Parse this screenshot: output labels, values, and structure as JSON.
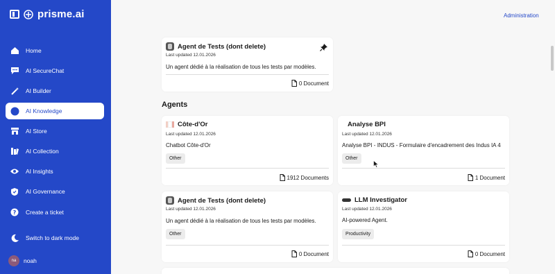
{
  "brand": {
    "name": "prisme.ai"
  },
  "sidebar": {
    "items": [
      {
        "label": "Home",
        "icon": "home-icon"
      },
      {
        "label": "AI SecureChat",
        "icon": "chat-icon"
      },
      {
        "label": "AI Builder",
        "icon": "magic-wand-icon"
      },
      {
        "label": "AI Knowledge",
        "icon": "knowledge-icon",
        "active": true
      },
      {
        "label": "AI Store",
        "icon": "store-icon"
      },
      {
        "label": "AI Collection",
        "icon": "collection-icon"
      },
      {
        "label": "AI Insights",
        "icon": "eye-icon"
      },
      {
        "label": "AI Governance",
        "icon": "shield-icon"
      },
      {
        "label": "Create a ticket",
        "icon": "help-icon"
      },
      {
        "label": "Switch to dark mode",
        "icon": "moon-icon"
      }
    ],
    "user": {
      "initials": "na",
      "name": "noah"
    }
  },
  "header": {
    "admin_link": "Administration"
  },
  "pinned": {
    "title": "Agent de Tests (dont delete)",
    "updated": "Last updated 12.01.2026",
    "description": "Un agent dédié à la réalisation de tous les tests par modèles.",
    "docs": "0 Document"
  },
  "agents_section": {
    "title": "Agents"
  },
  "agents": [
    {
      "title": "Côte-d'Or",
      "updated": "Last updated 12.01.2026",
      "description": "Chatbot Côte-d'Or",
      "tag": "Other",
      "docs": "1912 Documents"
    },
    {
      "title": "Analyse BPI",
      "updated": "Last updated 12.01.2026",
      "description": "Analyse BPI - INDUS - Formulaire d'encadrement des Indus IA 4",
      "tag": "Other",
      "docs": "1 Document"
    },
    {
      "title": "Agent de Tests (dont delete)",
      "updated": "Last updated 12.01.2026",
      "description": "Un agent dédié à la réalisation de tous les tests par modèles.",
      "tag": "Other",
      "docs": "0 Document"
    },
    {
      "title": "LLM Investigator",
      "updated": "Last updated 12.01.2026",
      "description": "AI-powered Agent.",
      "tag": "Productivity",
      "docs": "0 Document"
    }
  ],
  "colors": {
    "sidebar": "#2448c8",
    "accent": "#2448c8",
    "background": "#f7f7f7"
  }
}
